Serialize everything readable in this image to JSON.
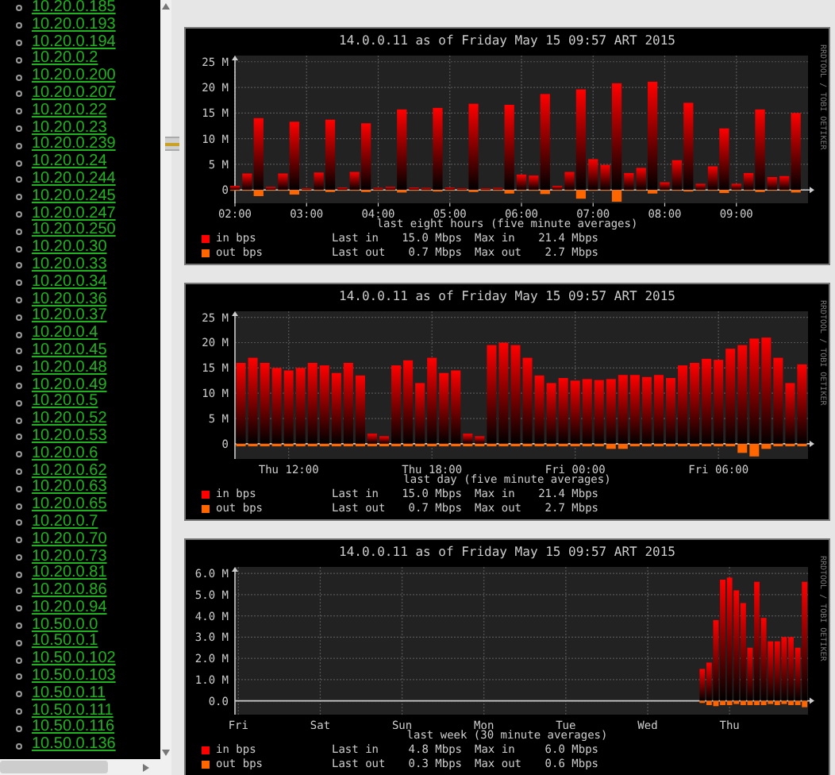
{
  "sidebar": {
    "items": [
      "10.20.0.185",
      "10.20.0.193",
      "10.20.0.194",
      "10.20.0.2",
      "10.20.0.200",
      "10.20.0.207",
      "10.20.0.22",
      "10.20.0.23",
      "10.20.0.239",
      "10.20.0.24",
      "10.20.0.244",
      "10.20.0.245",
      "10.20.0.247",
      "10.20.0.250",
      "10.20.0.30",
      "10.20.0.33",
      "10.20.0.34",
      "10.20.0.36",
      "10.20.0.37",
      "10.20.0.4",
      "10.20.0.45",
      "10.20.0.48",
      "10.20.0.49",
      "10.20.0.5",
      "10.20.0.52",
      "10.20.0.53",
      "10.20.0.6",
      "10.20.0.62",
      "10.20.0.63",
      "10.20.0.65",
      "10.20.0.7",
      "10.20.0.70",
      "10.20.0.73",
      "10.20.0.81",
      "10.20.0.86",
      "10.20.0.94",
      "10.50.0.0",
      "10.50.0.1",
      "10.50.0.102",
      "10.50.0.103",
      "10.50.0.11",
      "10.50.0.111",
      "10.50.0.116",
      "10.50.0.136"
    ]
  },
  "graphs": [
    {
      "title": "14.0.0.11 as of Friday May 15 09:57 ART 2015",
      "side_text": "RRDTOOL / TOBI OETIKER",
      "chart_data": {
        "type": "bar",
        "grid": true,
        "xlabel": "last eight hours (five minute averages)",
        "xlim": [
          2,
          10
        ],
        "ylim": [
          -2.6,
          26.2
        ],
        "xticks": [
          {
            "value": 2,
            "label": "02:00"
          },
          {
            "value": 3,
            "label": "03:00"
          },
          {
            "value": 4,
            "label": "04:00"
          },
          {
            "value": 5,
            "label": "05:00"
          },
          {
            "value": 6,
            "label": "06:00"
          },
          {
            "value": 7,
            "label": "07:00"
          },
          {
            "value": 8,
            "label": "08:00"
          },
          {
            "value": 9,
            "label": "09:00"
          }
        ],
        "yticks": [
          {
            "value": 0,
            "label": "0"
          },
          {
            "value": 5,
            "label": "5 M"
          },
          {
            "value": 10,
            "label": "10 M"
          },
          {
            "value": 15,
            "label": "15 M"
          },
          {
            "value": 20,
            "label": "20 M"
          },
          {
            "value": 25,
            "label": "25 M"
          }
        ],
        "x": [
          2,
          2.17,
          2.33,
          2.5,
          2.67,
          2.83,
          3,
          3.17,
          3.33,
          3.5,
          3.67,
          3.83,
          4,
          4.17,
          4.33,
          4.5,
          4.67,
          4.83,
          5,
          5.17,
          5.33,
          5.5,
          5.67,
          5.83,
          6,
          6.17,
          6.33,
          6.5,
          6.67,
          6.83,
          7,
          7.17,
          7.33,
          7.5,
          7.67,
          7.83,
          8,
          8.17,
          8.33,
          8.5,
          8.67,
          8.83,
          9,
          9.17,
          9.33,
          9.5,
          9.67,
          9.83
        ],
        "series": [
          {
            "name": "in bps",
            "color": "#ff0000",
            "values": [
              0.8,
              3.2,
              14,
              0.6,
              3.2,
              13.3,
              0.3,
              3.4,
              13.7,
              0.5,
              3.5,
              13,
              0.4,
              0.6,
              15.7,
              0.5,
              0.4,
              16,
              0.5,
              0.3,
              16.8,
              0.3,
              0.4,
              16.6,
              3,
              2.8,
              18.7,
              0.8,
              3.5,
              19.6,
              6,
              4.9,
              20.8,
              3.3,
              4.3,
              21.1,
              1.5,
              5.8,
              17,
              1.2,
              4.6,
              12,
              1.2,
              3.3,
              15.7,
              2.5,
              2.7,
              15
            ]
          },
          {
            "name": "out bps",
            "color": "#ff6600",
            "values": [
              -0.1,
              -0.1,
              -1.2,
              -0.1,
              -0.1,
              -0.9,
              -0.1,
              -0.1,
              -0.4,
              -0.1,
              -0.1,
              -0.4,
              -0.1,
              -0.1,
              -0.5,
              -0.1,
              -0.1,
              -0.3,
              -0.1,
              -0.1,
              -0.4,
              -0.1,
              -0.1,
              -0.7,
              -0.1,
              -0.1,
              -0.8,
              -0.1,
              -0.1,
              -1.7,
              -0.1,
              -0.1,
              -2.3,
              -0.1,
              -0.1,
              -0.7,
              -0.1,
              -0.1,
              -0.3,
              -0.1,
              -0.1,
              -0.6,
              -0.1,
              -0.1,
              -0.4,
              -0.1,
              -0.1,
              -0.5
            ]
          }
        ]
      },
      "legend": [
        {
          "last_label": "Last in",
          "last": "15.0 Mbps",
          "max_label": "Max in",
          "max": "21.4 Mbps"
        },
        {
          "last_label": "Last out",
          "last": "0.7 Mbps",
          "max_label": "Max out",
          "max": "2.7 Mbps"
        }
      ]
    },
    {
      "title": "14.0.0.11 as of Friday May 15 09:57 ART 2015",
      "side_text": "RRDTOOL / TOBI OETIKER",
      "chart_data": {
        "type": "bar",
        "grid": true,
        "xlabel": "last day (five minute averages)",
        "ylim": [
          -3,
          26.2
        ],
        "categories": [
          null,
          null,
          null,
          null,
          "Thu 12:00",
          null,
          null,
          null,
          null,
          null,
          null,
          null,
          null,
          null,
          null,
          null,
          "Thu 18:00",
          null,
          null,
          null,
          null,
          null,
          null,
          null,
          null,
          null,
          null,
          null,
          "Fri 00:00",
          null,
          null,
          null,
          null,
          null,
          null,
          null,
          null,
          null,
          null,
          null,
          "Fri 06:00",
          null,
          null,
          null,
          null,
          null,
          null,
          null
        ],
        "yticks": [
          {
            "value": 0,
            "label": "0"
          },
          {
            "value": 5,
            "label": "5 M"
          },
          {
            "value": 10,
            "label": "10 M"
          },
          {
            "value": 15,
            "label": "15 M"
          },
          {
            "value": 20,
            "label": "20 M"
          },
          {
            "value": 25,
            "label": "25 M"
          }
        ],
        "series": [
          {
            "name": "in bps",
            "color": "#ff0000",
            "values": [
              16,
              17,
              16,
              15,
              14.5,
              15,
              16,
              15.5,
              14,
              16,
              13.5,
              2,
              1.5,
              15.5,
              16.5,
              12,
              17,
              14,
              14.5,
              2,
              1.5,
              19.5,
              20,
              19.5,
              17,
              13.5,
              12,
              13,
              12.5,
              12.8,
              12.6,
              12.8,
              13.6,
              13.6,
              13.2,
              13.6,
              13,
              15.5,
              16,
              16.8,
              16.6,
              18.8,
              19.5,
              20.8,
              21,
              17,
              12,
              15.7
            ]
          },
          {
            "name": "out bps",
            "color": "#ff6600",
            "values": [
              -0.5,
              -0.5,
              -0.5,
              -0.5,
              -0.5,
              -0.5,
              -0.5,
              -0.5,
              -0.5,
              -0.5,
              -0.5,
              -0.5,
              -0.5,
              -0.5,
              -0.5,
              -0.5,
              -0.5,
              -0.5,
              -0.5,
              -0.5,
              -0.5,
              -0.5,
              -0.5,
              -0.5,
              -0.5,
              -0.5,
              -0.5,
              -0.5,
              -0.5,
              -0.5,
              -0.5,
              -1,
              -1,
              -0.5,
              -0.5,
              -0.5,
              -0.5,
              -0.5,
              -0.5,
              -0.5,
              -0.5,
              -0.5,
              -1.8,
              -2.5,
              -1,
              -0.5,
              -0.5,
              -0.5
            ]
          }
        ]
      },
      "legend": [
        {
          "last_label": "Last in",
          "last": "15.0 Mbps",
          "max_label": "Max in",
          "max": "21.4 Mbps"
        },
        {
          "last_label": "Last out",
          "last": "0.7 Mbps",
          "max_label": "Max out",
          "max": "2.7 Mbps"
        }
      ]
    },
    {
      "title": "14.0.0.11 as of Friday May 15 09:57 ART 2015",
      "side_text": "RRDTOOL / TOBI OETIKER",
      "chart_data": {
        "type": "bar",
        "grid": true,
        "xlabel": "last week (30 minute averages)",
        "ylim": [
          -0.65,
          6.3
        ],
        "categories": [
          "Fri",
          null,
          null,
          null,
          null,
          null,
          null,
          null,
          null,
          null,
          null,
          null,
          "Sat",
          null,
          null,
          null,
          null,
          null,
          null,
          null,
          null,
          null,
          null,
          null,
          "Sun",
          null,
          null,
          null,
          null,
          null,
          null,
          null,
          null,
          null,
          null,
          null,
          "Mon",
          null,
          null,
          null,
          null,
          null,
          null,
          null,
          null,
          null,
          null,
          null,
          "Tue",
          null,
          null,
          null,
          null,
          null,
          null,
          null,
          null,
          null,
          null,
          null,
          "Wed",
          null,
          null,
          null,
          null,
          null,
          null,
          null,
          null,
          null,
          null,
          null,
          "Thu",
          null,
          null,
          null,
          null,
          null,
          null,
          null,
          null,
          null,
          null,
          null
        ],
        "yticks": [
          {
            "value": 0,
            "label": "0.0"
          },
          {
            "value": 1,
            "label": "1.0 M"
          },
          {
            "value": 2,
            "label": "2.0 M"
          },
          {
            "value": 3,
            "label": "3.0 M"
          },
          {
            "value": 4,
            "label": "4.0 M"
          },
          {
            "value": 5,
            "label": "5.0 M"
          },
          {
            "value": 6,
            "label": "6.0 M"
          }
        ],
        "series": [
          {
            "name": "in bps",
            "color": "#ff0000",
            "values": [
              null,
              null,
              null,
              null,
              null,
              null,
              null,
              null,
              null,
              null,
              null,
              null,
              null,
              null,
              null,
              null,
              null,
              null,
              null,
              null,
              null,
              null,
              null,
              null,
              null,
              null,
              null,
              null,
              null,
              null,
              null,
              null,
              null,
              null,
              null,
              null,
              null,
              null,
              null,
              null,
              null,
              null,
              null,
              null,
              null,
              null,
              null,
              null,
              null,
              null,
              null,
              null,
              null,
              null,
              null,
              null,
              null,
              null,
              null,
              null,
              null,
              null,
              null,
              null,
              null,
              null,
              null,
              null,
              1.5,
              1.8,
              3.8,
              5.7,
              5.8,
              5.2,
              4.6,
              2.5,
              5.6,
              3.9,
              2.8,
              2.8,
              3.0,
              3.0,
              2.5,
              5.6
            ]
          },
          {
            "name": "out bps",
            "color": "#ff6600",
            "values": [
              null,
              null,
              null,
              null,
              null,
              null,
              null,
              null,
              null,
              null,
              null,
              null,
              null,
              null,
              null,
              null,
              null,
              null,
              null,
              null,
              null,
              null,
              null,
              null,
              null,
              null,
              null,
              null,
              null,
              null,
              null,
              null,
              null,
              null,
              null,
              null,
              null,
              null,
              null,
              null,
              null,
              null,
              null,
              null,
              null,
              null,
              null,
              null,
              null,
              null,
              null,
              null,
              null,
              null,
              null,
              null,
              null,
              null,
              null,
              null,
              null,
              null,
              null,
              null,
              null,
              null,
              null,
              null,
              -0.1,
              -0.2,
              -0.25,
              -0.2,
              -0.2,
              -0.15,
              -0.2,
              -0.2,
              -0.2,
              -0.2,
              -0.15,
              -0.2,
              -0.15,
              -0.2,
              -0.2,
              -0.3
            ]
          }
        ]
      },
      "legend": [
        {
          "last_label": "Last in",
          "last": "4.8 Mbps",
          "max_label": "Max in",
          "max": "6.0 Mbps"
        },
        {
          "last_label": "Last out",
          "last": "0.3 Mbps",
          "max_label": "Max out",
          "max": "0.6 Mbps"
        }
      ]
    }
  ]
}
